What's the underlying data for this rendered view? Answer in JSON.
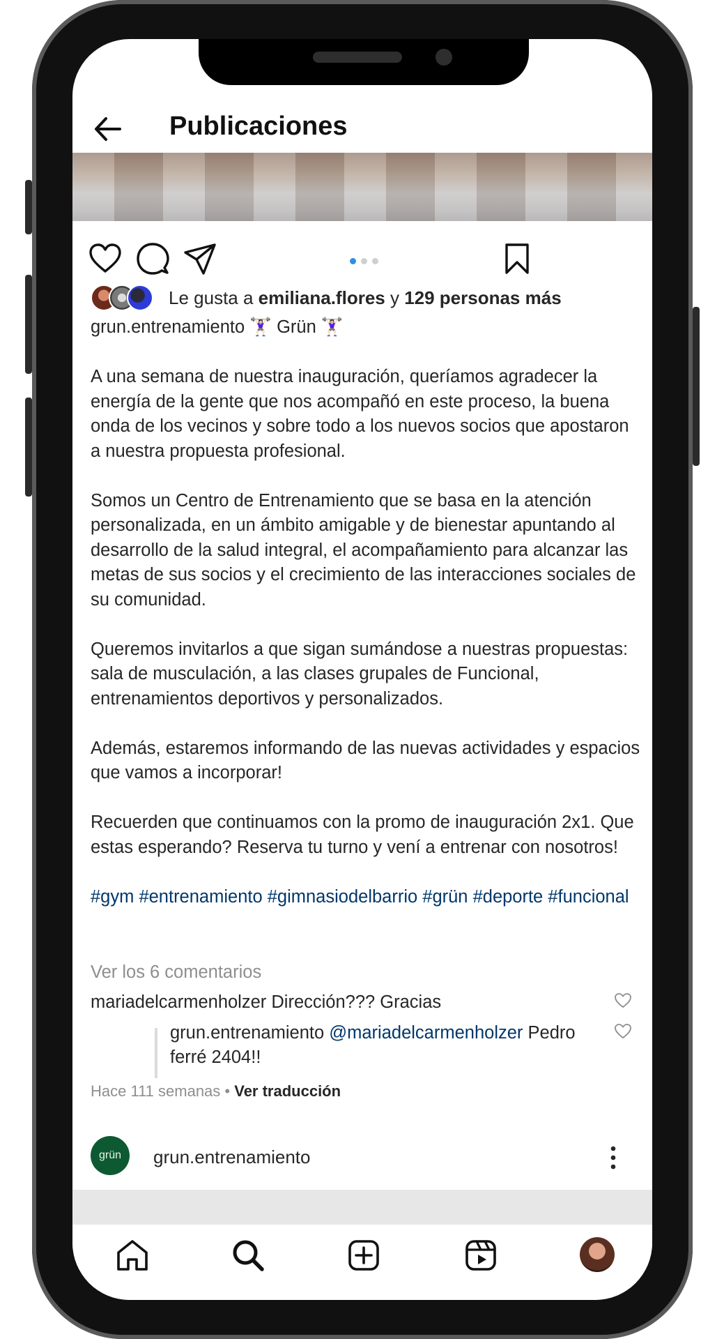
{
  "header": {
    "title": "Publicaciones"
  },
  "carousel": {
    "total": 3,
    "active_index": 0
  },
  "likes": {
    "prefix": "Le gusta a ",
    "user": "emiliana.flores",
    "connector": " y ",
    "others": "129 personas más"
  },
  "post": {
    "username": "grun.entrenamiento",
    "title_line": " 🏋🏻‍♀️ Grün 🏋🏻‍♀️",
    "paragraphs": [
      "A una semana de nuestra inauguración, queríamos agradecer la energía de la gente que nos acompañó en este proceso, la buena onda de los vecinos y sobre todo a los nuevos socios que apostaron a nuestra propuesta profesional.",
      "Somos un Centro de Entrenamiento que se basa en la atención personalizada, en un ámbito amigable y de bienestar apuntando al desarrollo de la salud integral, el acompañamiento para alcanzar las metas de sus socios y el crecimiento de las interacciones sociales de su comunidad.",
      "Queremos invitarlos a que sigan sumándose a nuestras propuestas: sala de musculación, a las clases grupales de Funcional, entrenamientos deportivos y personalizados.",
      "Además, estaremos informando de las nuevas actividades y espacios que vamos a incorporar!",
      "Recuerden que continuamos con la promo de inauguración 2x1. Que estas esperando? Reserva tu turno y vení a entrenar con nosotros!"
    ],
    "hashtags": "#gym #entrenamiento #gimnasiodelbarrio #grün #deporte #funcional"
  },
  "comments": {
    "view_all": "Ver los 6 comentarios",
    "items": [
      {
        "user": "mariadelcarmenholzer",
        "text": " Dirección??? Gracias"
      },
      {
        "user": "grun.entrenamiento",
        "mention": "@mariadelcarmenholzer",
        "text": " Pedro ferré 2404!!"
      }
    ],
    "time": "Hace 111 semanas",
    "separator": " • ",
    "translate": "Ver traducción"
  },
  "next_post": {
    "avatar_text": "grün",
    "username": "grun.entrenamiento"
  },
  "colors": {
    "link": "#00376b",
    "secondary": "#8e8e8e",
    "dot_active": "#2f8fe8",
    "brand_green": "#0d5a32"
  },
  "icons": [
    "back-arrow-icon",
    "heart-icon",
    "comment-icon",
    "share-icon",
    "bookmark-icon",
    "more-vertical-icon",
    "home-icon",
    "search-icon",
    "add-post-icon",
    "reels-icon"
  ]
}
